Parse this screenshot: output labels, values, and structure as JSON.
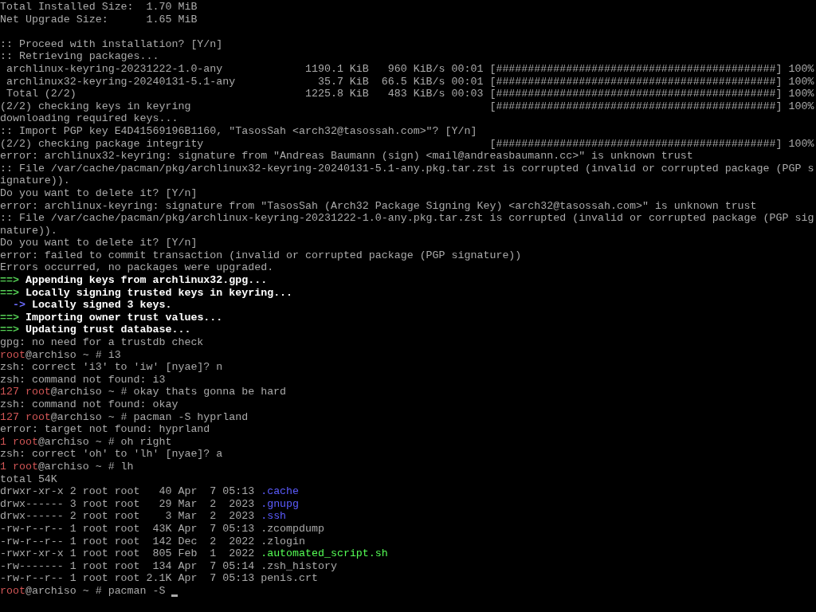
{
  "terminal": {
    "lines": [
      {
        "text": "Total Installed Size:  1.70 MiB"
      },
      {
        "text": "Net Upgrade Size:      1.65 MiB"
      },
      {
        "kind": "blank"
      },
      {
        "text": ":: Proceed with installation? [Y/n]"
      },
      {
        "text": ":: Retrieving packages..."
      },
      {
        "text": " archlinux-keyring-20231222-1.0-any             1190.1 KiB   960 KiB/s 00:01 [############################################] 100%"
      },
      {
        "text": " archlinux32-keyring-20240131-5.1-any             35.7 KiB  66.5 KiB/s 00:01 [############################################] 100%"
      },
      {
        "text": " Total (2/2)                                    1225.8 KiB   483 KiB/s 00:03 [############################################] 100%"
      },
      {
        "text": "(2/2) checking keys in keyring                                               [############################################] 100%"
      },
      {
        "text": "downloading required keys..."
      },
      {
        "text": ":: Import PGP key E4D41569196B1160, \"TasosSah <arch32@tasossah.com>\"? [Y/n]"
      },
      {
        "text": "(2/2) checking package integrity                                             [############################################] 100%"
      },
      {
        "text": "error: archlinux32-keyring: signature from \"Andreas Baumann (sign) <mail@andreasbaumann.cc>\" is unknown trust"
      },
      {
        "text": ":: File /var/cache/pacman/pkg/archlinux32-keyring-20240131-5.1-any.pkg.tar.zst is corrupted (invalid or corrupted package (PGP s"
      },
      {
        "text": "ignature))."
      },
      {
        "text": "Do you want to delete it? [Y/n]"
      },
      {
        "text": "error: archlinux-keyring: signature from \"TasosSah (Arch32 Package Signing Key) <arch32@tasossah.com>\" is unknown trust"
      },
      {
        "text": ":: File /var/cache/pacman/pkg/archlinux-keyring-20231222-1.0-any.pkg.tar.zst is corrupted (invalid or corrupted package (PGP sig"
      },
      {
        "text": "nature))."
      },
      {
        "text": "Do you want to delete it? [Y/n]"
      },
      {
        "text": "error: failed to commit transaction (invalid or corrupted package (PGP signature))"
      },
      {
        "text": "Errors occurred, no packages were upgraded."
      },
      {
        "segments": [
          {
            "kind": "stage-arrow",
            "text": "==>"
          },
          {
            "kind": "heading",
            "text": " Appending keys from archlinux32.gpg..."
          }
        ]
      },
      {
        "segments": [
          {
            "kind": "stage-arrow",
            "text": "==>"
          },
          {
            "kind": "heading",
            "text": " Locally signing trusted keys in keyring..."
          }
        ]
      },
      {
        "segments": [
          {
            "kind": "step-arrow",
            "text": "  ->"
          },
          {
            "kind": "heading",
            "text": " Locally signed 3 keys."
          }
        ]
      },
      {
        "segments": [
          {
            "kind": "stage-arrow",
            "text": "==>"
          },
          {
            "kind": "heading",
            "text": " Importing owner trust values..."
          }
        ]
      },
      {
        "segments": [
          {
            "kind": "stage-arrow",
            "text": "==>"
          },
          {
            "kind": "heading",
            "text": " Updating trust database..."
          }
        ]
      },
      {
        "text": "gpg: no need for a trustdb check"
      },
      {
        "segments": [
          {
            "kind": "user",
            "text": "root"
          },
          {
            "kind": "plain",
            "text": "@archiso ~ # i3"
          }
        ]
      },
      {
        "text": "zsh: correct 'i3' to 'iw' [nyae]? n"
      },
      {
        "text": "zsh: command not found: i3"
      },
      {
        "segments": [
          {
            "kind": "status",
            "text": "127 "
          },
          {
            "kind": "user",
            "text": "root"
          },
          {
            "kind": "plain",
            "text": "@archiso ~ # okay thats gonna be hard"
          }
        ]
      },
      {
        "text": "zsh: command not found: okay"
      },
      {
        "segments": [
          {
            "kind": "status",
            "text": "127 "
          },
          {
            "kind": "user",
            "text": "root"
          },
          {
            "kind": "plain",
            "text": "@archiso ~ # pacman -S hyprland"
          }
        ]
      },
      {
        "text": "error: target not found: hyprland"
      },
      {
        "segments": [
          {
            "kind": "status",
            "text": "1 "
          },
          {
            "kind": "user",
            "text": "root"
          },
          {
            "kind": "plain",
            "text": "@archiso ~ # oh right"
          }
        ]
      },
      {
        "text": "zsh: correct 'oh' to 'lh' [nyae]? a"
      },
      {
        "segments": [
          {
            "kind": "status",
            "text": "1 "
          },
          {
            "kind": "user",
            "text": "root"
          },
          {
            "kind": "plain",
            "text": "@archiso ~ # lh"
          }
        ]
      },
      {
        "text": "total 54K"
      },
      {
        "segments": [
          {
            "kind": "plain",
            "text": "drwxr-xr-x 2 root root   40 Apr  7 05:13 "
          },
          {
            "kind": "directory",
            "text": ".cache"
          }
        ]
      },
      {
        "segments": [
          {
            "kind": "plain",
            "text": "drwx------ 3 root root   29 Mar  2  2023 "
          },
          {
            "kind": "directory",
            "text": ".gnupg"
          }
        ]
      },
      {
        "segments": [
          {
            "kind": "plain",
            "text": "drwx------ 2 root root    3 Mar  2  2023 "
          },
          {
            "kind": "directory",
            "text": ".ssh"
          }
        ]
      },
      {
        "text": "-rw-r--r-- 1 root root  43K Apr  7 05:13 .zcompdump"
      },
      {
        "text": "-rw-r--r-- 1 root root  142 Dec  2  2022 .zlogin"
      },
      {
        "segments": [
          {
            "kind": "plain",
            "text": "-rwxr-xr-x 1 root root  805 Feb  1  2022 "
          },
          {
            "kind": "executable",
            "text": ".automated_script.sh"
          }
        ]
      },
      {
        "text": "-rw------- 1 root root  134 Apr  7 05:14 .zsh_history"
      },
      {
        "text": "-rw-r--r-- 1 root root 2.1K Apr  7 05:13 penis.crt"
      },
      {
        "segments": [
          {
            "kind": "user",
            "text": "root"
          },
          {
            "kind": "plain",
            "text": "@archiso ~ # pacman -S "
          }
        ],
        "cursor": true
      }
    ]
  }
}
